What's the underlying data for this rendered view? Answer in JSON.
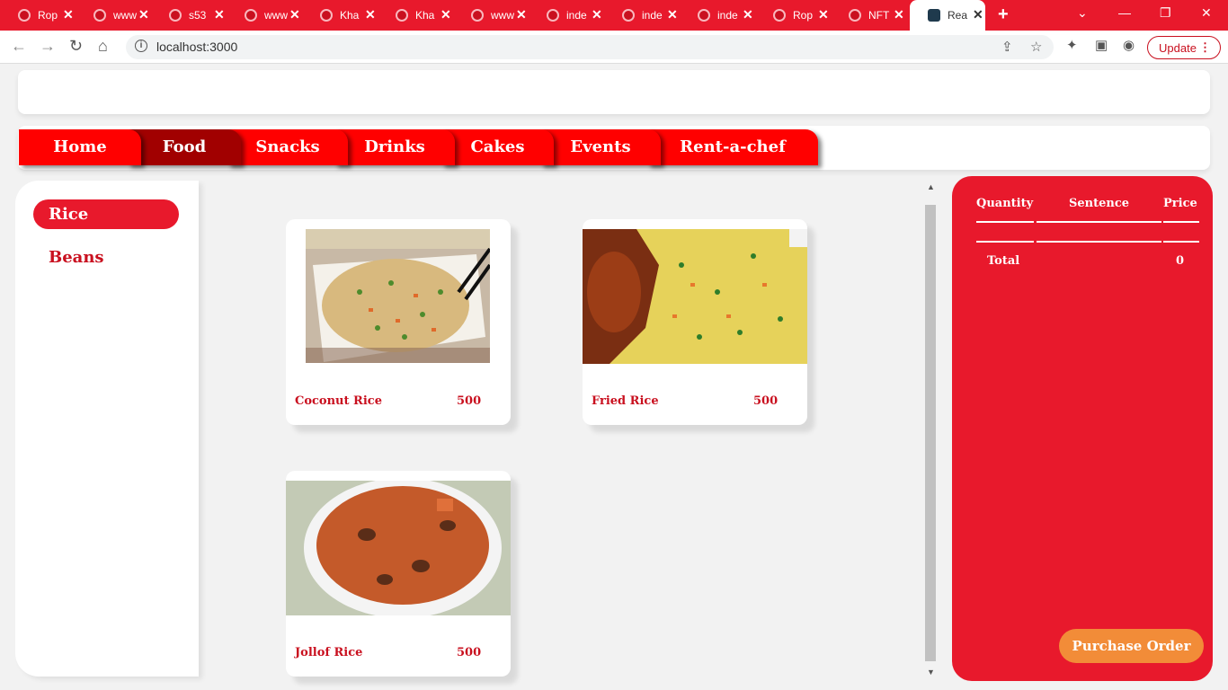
{
  "browser": {
    "tabs": [
      {
        "title": "Rop"
      },
      {
        "title": "www"
      },
      {
        "title": "s53"
      },
      {
        "title": "www"
      },
      {
        "title": "Kha"
      },
      {
        "title": "Kha"
      },
      {
        "title": "www"
      },
      {
        "title": "inde"
      },
      {
        "title": "inde"
      },
      {
        "title": "inde"
      },
      {
        "title": "Rop"
      },
      {
        "title": "NFT"
      },
      {
        "title": "Rea"
      }
    ],
    "url": "localhost:3000",
    "update_label": "Update"
  },
  "nav": {
    "items": [
      "Home",
      "Food",
      "Snacks",
      "Drinks",
      "Cakes",
      "Events",
      "Rent-a-chef"
    ],
    "active": "Food"
  },
  "sidebar": {
    "categories": [
      "Rice",
      "Beans"
    ],
    "active": "Rice"
  },
  "products": [
    {
      "name": "Coconut Rice",
      "price": "500"
    },
    {
      "name": "Fried Rice",
      "price": "500"
    },
    {
      "name": "Jollof Rice",
      "price": "500"
    }
  ],
  "cart": {
    "headers": {
      "quantity": "Quantity",
      "sentence": "Sentence",
      "price": "Price"
    },
    "total_label": "Total",
    "total_value": "0",
    "purchase_label": "Purchase Order"
  },
  "colors": {
    "brand_red": "#e8192c",
    "nav_red": "#ff0000",
    "nav_active": "#a10000",
    "purchase_orange": "#f28c38"
  }
}
